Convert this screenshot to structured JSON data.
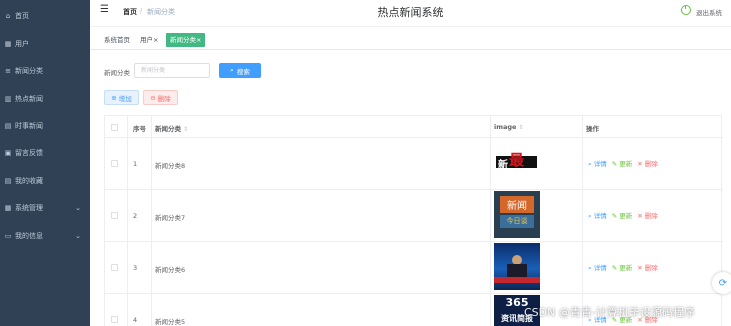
{
  "app": {
    "title": "热点新闻系统",
    "logout_label": "退出系统"
  },
  "breadcrumb": {
    "home": "首页",
    "separator": "/",
    "current": "新闻分类"
  },
  "sidebar": {
    "items": [
      {
        "label": "首页",
        "icon": "home-icon",
        "glyph": "⌂"
      },
      {
        "label": "用户",
        "icon": "grid-icon",
        "glyph": "▦"
      },
      {
        "label": "新闻分类",
        "icon": "list-icon",
        "glyph": "≡"
      },
      {
        "label": "热点新闻",
        "icon": "columns-icon",
        "glyph": "▥"
      },
      {
        "label": "时事新闻",
        "icon": "document-icon",
        "glyph": "▤"
      },
      {
        "label": "留言反馈",
        "icon": "message-icon",
        "glyph": "▣"
      },
      {
        "label": "我的收藏",
        "icon": "folder-icon",
        "glyph": "▤"
      },
      {
        "label": "系统管理",
        "icon": "grid-icon",
        "glyph": "▦",
        "chevron": "⌄"
      },
      {
        "label": "我的信息",
        "icon": "profile-icon",
        "glyph": "▭",
        "chevron": "⌄"
      }
    ]
  },
  "tags": {
    "home": "系统首页",
    "users": "用户",
    "category": "新闻分类",
    "close_glyph": "×"
  },
  "search": {
    "label": "新闻分类",
    "placeholder": "新闻分类",
    "value": "",
    "button_label": "搜索",
    "button_icon": "⌕"
  },
  "actions": {
    "add_label": "增加",
    "add_icon": "⊕",
    "delete_label": "删除",
    "delete_icon": "⊖"
  },
  "table": {
    "headers": {
      "index": "序号",
      "name": "新闻分类",
      "image": "image",
      "ops": "操作",
      "sort_icon": "⇕"
    },
    "rows": [
      {
        "index": "1",
        "name": "新闻分类8"
      },
      {
        "index": "2",
        "name": "新闻分类7"
      },
      {
        "index": "3",
        "name": "新闻分类6"
      },
      {
        "index": "4",
        "name": "新闻分类5"
      }
    ],
    "row_actions": {
      "detail": "详情",
      "update": "更新",
      "delete": "删除",
      "detail_icon": "⌕",
      "update_icon": "✎",
      "delete_icon": "✕"
    }
  },
  "thumbs": {
    "t1": {
      "line1": "新",
      "line2": "最"
    },
    "t2": {
      "line1": "新闻",
      "line2": "今日谈"
    },
    "t4": {
      "line1": "365",
      "line2": "资讯简报"
    }
  },
  "watermark": "CSDN @青青-计算机毕设源码程序",
  "colors": {
    "sidebar": "#304156",
    "primary": "#409eff",
    "success": "#67c23a",
    "danger": "#f56c6c",
    "tag_active": "#42b983"
  }
}
